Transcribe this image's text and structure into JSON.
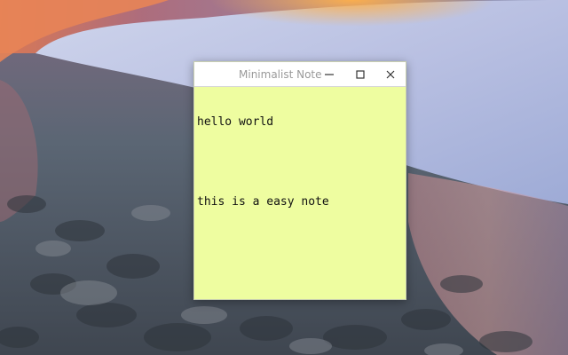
{
  "window": {
    "title": "Minimalist Note"
  },
  "note": {
    "lines": [
      "hello world",
      "",
      "this is a easy note"
    ],
    "background_color": "#eefda0"
  },
  "icons": {
    "minimize": "minimize-icon",
    "maximize": "maximize-icon",
    "close": "close-icon"
  }
}
